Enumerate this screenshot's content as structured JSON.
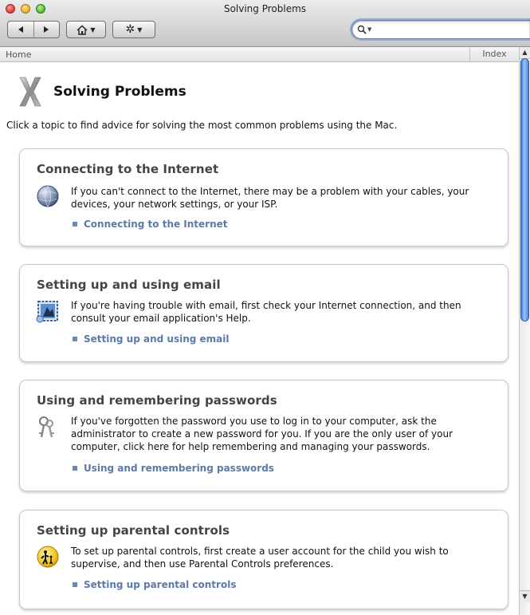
{
  "window": {
    "title": "Solving Problems"
  },
  "toolbar": {
    "back_icon": "back-arrow-icon",
    "forward_icon": "forward-arrow-icon",
    "home_icon": "house-icon",
    "action_icon": "gear-icon",
    "search_value": ""
  },
  "breadcrumb": {
    "home": "Home",
    "index": "Index"
  },
  "page": {
    "title": "Solving Problems",
    "intro": "Click a topic to find advice for solving the most common problems using the Mac."
  },
  "topics": [
    {
      "title": "Connecting to the Internet",
      "icon": "network-globe-icon",
      "description": "If you can't connect to the Internet, there may be a problem with your cables, your devices, your network settings, or your ISP.",
      "link": "Connecting to the Internet"
    },
    {
      "title": "Setting up and using email",
      "icon": "mail-stamp-icon",
      "description": "If you're having trouble with email, first check your Internet connection, and then consult your email application's Help.",
      "link": "Setting up and using email"
    },
    {
      "title": "Using and remembering passwords",
      "icon": "keys-icon",
      "description": "If you've forgotten the password you use to log in to your computer, ask the administrator to create a new password for you. If you are the only user of your computer, click here for help remembering and managing your passwords.",
      "link": "Using and remembering passwords"
    },
    {
      "title": "Setting up parental controls",
      "icon": "parental-controls-icon",
      "description": "To set up parental controls, first create a user account for the child you wish to supervise, and then use Parental Controls preferences.",
      "link": "Setting up parental controls"
    }
  ]
}
